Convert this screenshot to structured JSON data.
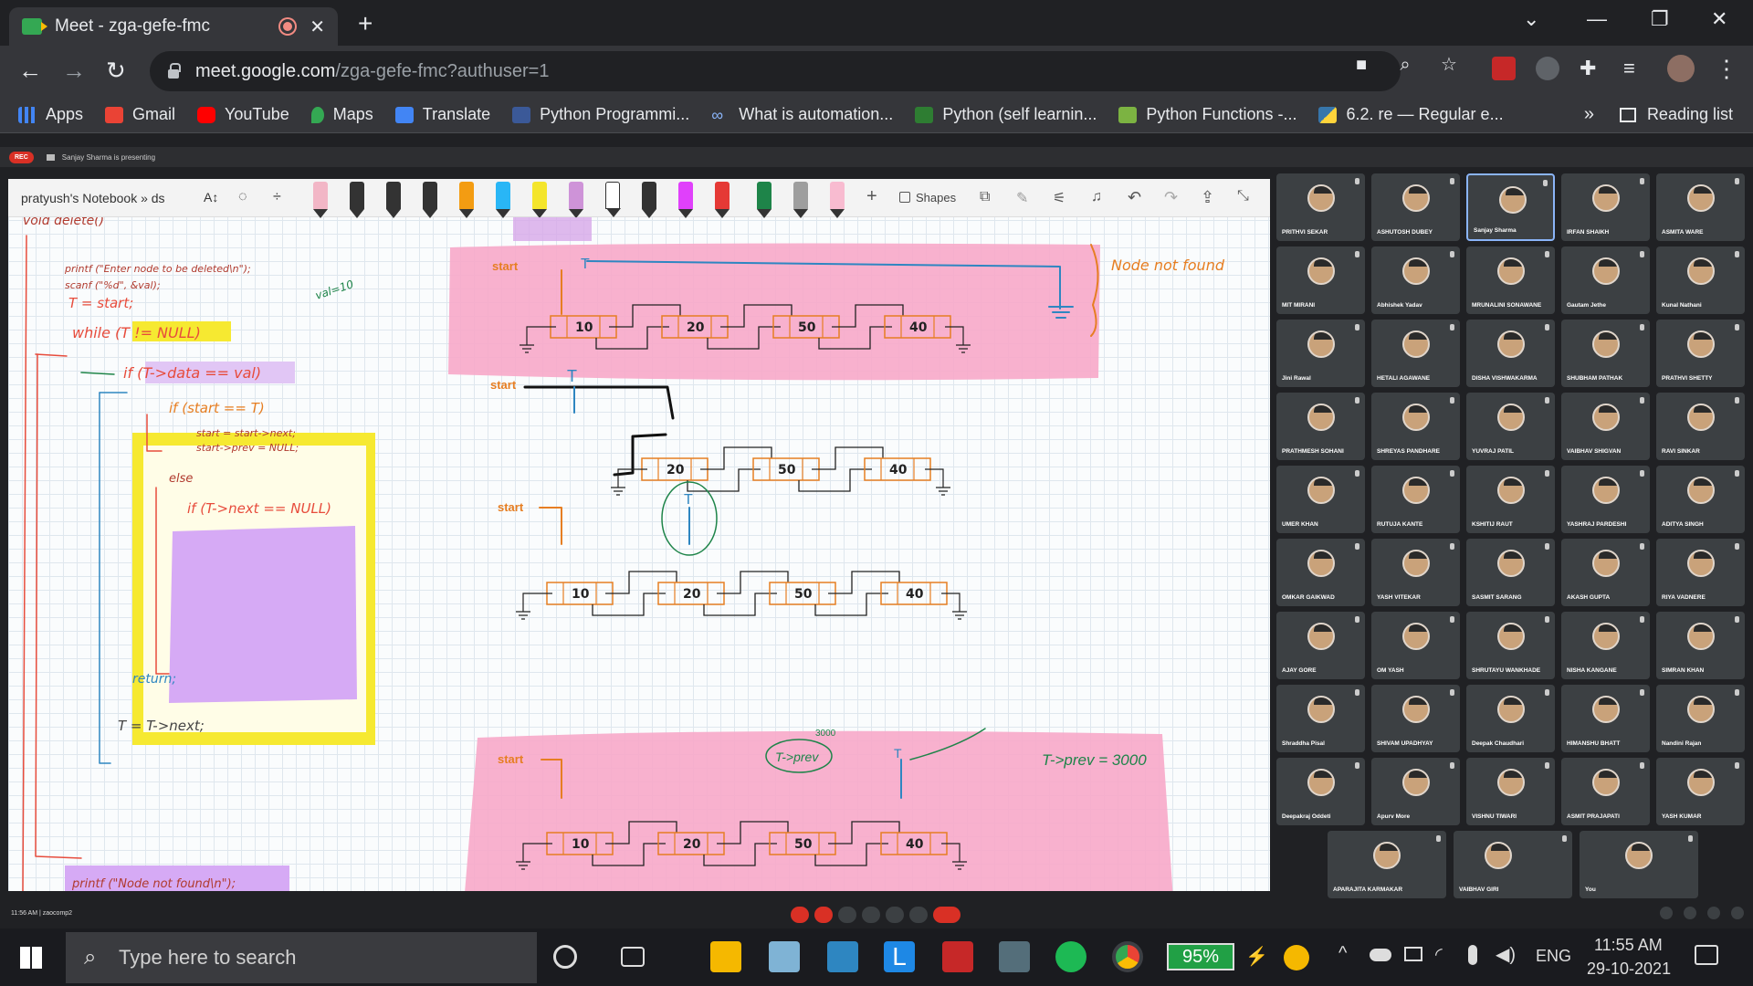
{
  "browser": {
    "tab_title": "Meet - zga-gefe-fmc",
    "url_host": "meet.google.com",
    "url_path": "/zga-gefe-fmc?authuser=1",
    "bookmarks": [
      {
        "label": "Apps",
        "color": "#4285f4"
      },
      {
        "label": "Gmail",
        "color": "#ea4335"
      },
      {
        "label": "YouTube",
        "color": "#ff0000"
      },
      {
        "label": "Maps",
        "color": "#34a853"
      },
      {
        "label": "Translate",
        "color": "#4285f4"
      },
      {
        "label": "Python Programmi...",
        "color": "#3b5998"
      },
      {
        "label": "What is automation...",
        "color": "#8ab4f8"
      },
      {
        "label": "Python (self learnin...",
        "color": "#2e7d32"
      },
      {
        "label": "Python Functions -...",
        "color": "#7cb342"
      },
      {
        "label": "6.2. re — Regular e...",
        "color": "#3776ab"
      }
    ],
    "bookmarks_overflow": "»",
    "reading_list": "Reading list"
  },
  "meet": {
    "rec_label": "REC",
    "presenting": "Sanjay Sharma is presenting",
    "time_code": "11:56 AM | zaocomp2",
    "notebook_title": "pratyush's Notebook » ds",
    "shapes_label": "Shapes",
    "participants": [
      "PRITHVI SEKAR",
      "ASHUTOSH DUBEY",
      "Sanjay Sharma",
      "IRFAN SHAIKH",
      "ASMITA WARE",
      "MIT MIRANI",
      "Abhishek Yadav",
      "MRUNALINI SONAWANE",
      "Gautam Jethe",
      "Kunal Nathani",
      "Jini Rawal",
      "HETALI AGAWANE",
      "DISHA VISHWAKARMA",
      "SHUBHAM PATHAK",
      "PRATHVI SHETTY",
      "PRATHMESH SOHANI",
      "SHREYAS PANDHARE",
      "YUVRAJ PATIL",
      "VAIBHAV SHIGVAN",
      "RAVI SINKAR",
      "UMER KHAN",
      "RUTUJA KANTE",
      "KSHITIJ RAUT",
      "YASHRAJ PARDESHI",
      "ADITYA SINGH",
      "OMKAR GAIKWAD",
      "YASH VITEKAR",
      "SASMIT SARANG",
      "AKASH GUPTA",
      "RIYA VADNERE",
      "AJAY GORE",
      "OM YASH",
      "SHRUTAYU WANKHADE",
      "NISHA KANGANE",
      "SIMRAN KHAN",
      "Shraddha Pisal",
      "SHIVAM UPADHYAY",
      "Deepak Chaudhari",
      "HIMANSHU BHATT",
      "Nandini Rajan",
      "Deepakraj Oddeti",
      "Apurv More",
      "VISHNU TIWARI",
      "ASMIT PRAJAPATI",
      "YASH KUMAR",
      "APARAJITA KARMAKAR",
      "VAIBHAV GIRI",
      "You"
    ]
  },
  "whiteboard": {
    "code": {
      "header": "void delete()",
      "printf1": "printf (\"Enter node to be deleted\\n\");",
      "scanf": "scanf (\"%d\", &val);",
      "assign": "T = start;",
      "val_note": "val=10",
      "while": "while (T != NULL)",
      "if1": "if (T->data == val)",
      "if2": "if (start == T)",
      "start_next": "start = start->next;",
      "start_prev": "start->prev = NULL;",
      "else": "else",
      "if3": "if (T->next == NULL)",
      "return": "return;",
      "t_next": "T = T->next;",
      "printf2": "printf (\"Node not found\\n\");"
    },
    "labels": {
      "start": "start",
      "T": "T",
      "node_not_found": "Node not found",
      "t_prev": "T->prev",
      "t_prev_eq": "T->prev = 3000",
      "addr": "3000"
    },
    "lists": [
      [
        "10",
        "20",
        "50",
        "40"
      ],
      [
        "20",
        "50",
        "40"
      ],
      [
        "10",
        "20",
        "50",
        "40"
      ],
      [
        "10",
        "20",
        "50",
        "40"
      ]
    ]
  },
  "taskbar": {
    "search_placeholder": "Type here to search",
    "battery": "95%",
    "lang": "ENG",
    "time": "11:55 AM",
    "date": "29-10-2021"
  }
}
